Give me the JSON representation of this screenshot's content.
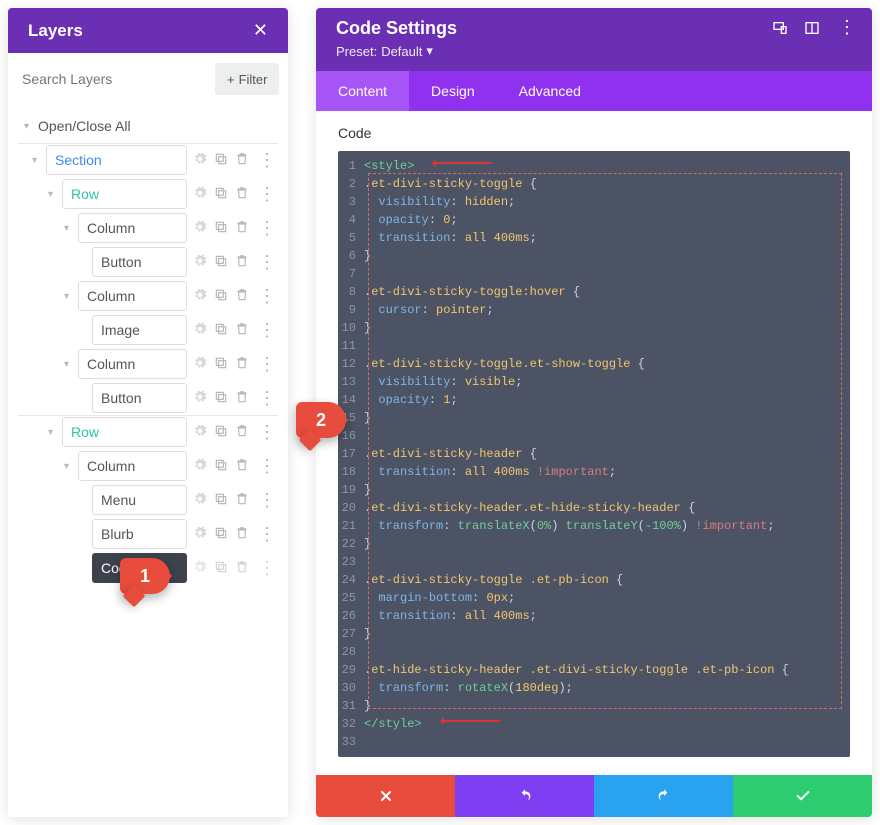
{
  "left": {
    "title": "Layers",
    "search_placeholder": "Search Layers",
    "filter_label": "Filter",
    "open_close": "Open/Close All",
    "items": [
      "Section",
      "Row",
      "Column",
      "Button",
      "Column",
      "Image",
      "Column",
      "Button",
      "Row",
      "Column",
      "Code"
    ],
    "menu_item": "Menu",
    "blurb_item": "Blurb"
  },
  "right": {
    "title": "Code Settings",
    "preset_label": "Preset:",
    "preset_value": "Default",
    "tabs": [
      "Content",
      "Design",
      "Advanced"
    ],
    "section_label": "Code",
    "code": [
      {
        "n": 1,
        "html": "<span class='t-tag'>&lt;style&gt;</span>"
      },
      {
        "n": 2,
        "html": "<span class='t-sel'>.et-divi-sticky-toggle</span> <span class='t-brace'>{</span>"
      },
      {
        "n": 3,
        "html": "  <span class='t-prop'>visibility</span><span class='t-punc'>:</span> <span class='t-val'>hidden</span><span class='t-punc'>;</span>"
      },
      {
        "n": 4,
        "html": "  <span class='t-prop'>opacity</span><span class='t-punc'>:</span> <span class='t-val'>0</span><span class='t-punc'>;</span>"
      },
      {
        "n": 5,
        "html": "  <span class='t-prop'>transition</span><span class='t-punc'>:</span> <span class='t-val'>all</span> <span class='t-val'>400ms</span><span class='t-punc'>;</span>"
      },
      {
        "n": 6,
        "html": "<span class='t-brace'>}</span>"
      },
      {
        "n": 7,
        "html": ""
      },
      {
        "n": 8,
        "html": "<span class='t-sel'>.et-divi-sticky-toggle:hover</span> <span class='t-brace'>{</span>"
      },
      {
        "n": 9,
        "html": "  <span class='t-prop'>cursor</span><span class='t-punc'>:</span> <span class='t-val'>pointer</span><span class='t-punc'>;</span>"
      },
      {
        "n": 10,
        "html": "<span class='t-brace'>}</span>"
      },
      {
        "n": 11,
        "html": ""
      },
      {
        "n": 12,
        "html": "<span class='t-sel'>.et-divi-sticky-toggle.et-show-toggle</span> <span class='t-brace'>{</span>"
      },
      {
        "n": 13,
        "html": "  <span class='t-prop'>visibility</span><span class='t-punc'>:</span> <span class='t-val'>visible</span><span class='t-punc'>;</span>"
      },
      {
        "n": 14,
        "html": "  <span class='t-prop'>opacity</span><span class='t-punc'>:</span> <span class='t-val'>1</span><span class='t-punc'>;</span>"
      },
      {
        "n": 15,
        "html": "<span class='t-brace'>}</span>"
      },
      {
        "n": 16,
        "html": ""
      },
      {
        "n": 17,
        "html": "<span class='t-sel'>.et-divi-sticky-header</span> <span class='t-brace'>{</span>"
      },
      {
        "n": 18,
        "html": "  <span class='t-prop'>transition</span><span class='t-punc'>:</span> <span class='t-val'>all</span> <span class='t-val'>400ms</span> <span class='t-imp'>!important</span><span class='t-punc'>;</span>"
      },
      {
        "n": 19,
        "html": "<span class='t-brace'>}</span>"
      },
      {
        "n": 20,
        "html": "<span class='t-sel'>.et-divi-sticky-header.et-hide-sticky-header</span> <span class='t-brace'>{</span>"
      },
      {
        "n": 21,
        "html": "  <span class='t-prop'>transform</span><span class='t-punc'>:</span> <span class='t-fn'>translateX</span>(<span class='t-pct'>0%</span>) <span class='t-fn'>translateY</span>(<span class='t-pct'>-100%</span>) <span class='t-imp'>!important</span><span class='t-punc'>;</span>"
      },
      {
        "n": 22,
        "html": "<span class='t-brace'>}</span>"
      },
      {
        "n": 23,
        "html": ""
      },
      {
        "n": 24,
        "html": "<span class='t-sel'>.et-divi-sticky-toggle .et-pb-icon</span> <span class='t-brace'>{</span>"
      },
      {
        "n": 25,
        "html": "  <span class='t-prop'>margin-bottom</span><span class='t-punc'>:</span> <span class='t-val'>0px</span><span class='t-punc'>;</span>"
      },
      {
        "n": 26,
        "html": "  <span class='t-prop'>transition</span><span class='t-punc'>:</span> <span class='t-val'>all</span> <span class='t-val'>400ms</span><span class='t-punc'>;</span>"
      },
      {
        "n": 27,
        "html": "<span class='t-brace'>}</span>"
      },
      {
        "n": 28,
        "html": ""
      },
      {
        "n": 29,
        "html": "<span class='t-sel'>.et-hide-sticky-header .et-divi-sticky-toggle .et-pb-icon</span> <span class='t-brace'>{</span>"
      },
      {
        "n": 30,
        "html": "  <span class='t-prop'>transform</span><span class='t-punc'>:</span> <span class='t-fn'>rotateX</span>(<span class='t-val'>180deg</span>)<span class='t-punc'>;</span>"
      },
      {
        "n": 31,
        "html": "<span class='t-brace'>}</span>"
      },
      {
        "n": 32,
        "html": "<span class='t-tag'>&lt;/style&gt;</span>"
      },
      {
        "n": 33,
        "html": ""
      }
    ]
  },
  "badges": {
    "b1": "1",
    "b2": "2"
  }
}
